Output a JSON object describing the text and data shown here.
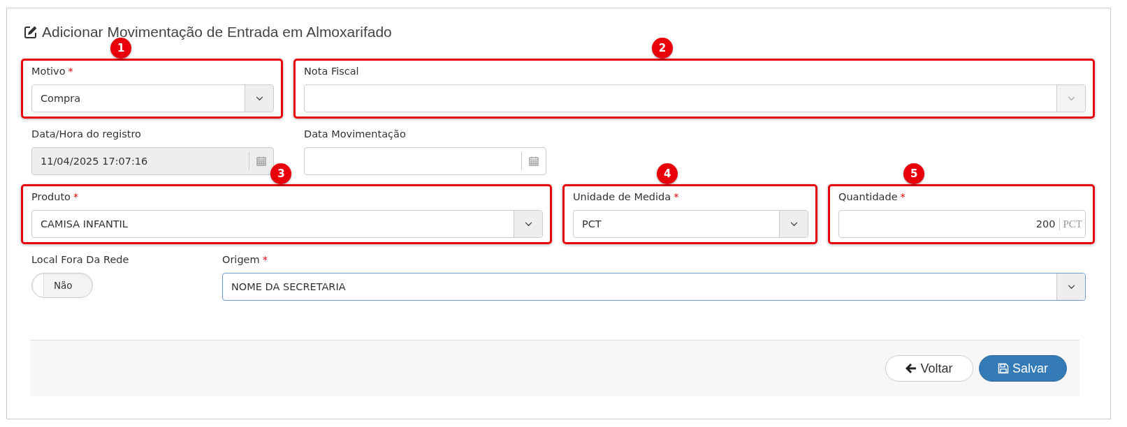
{
  "form": {
    "title": "Adicionar Movimentação de Entrada em Almoxarifado",
    "rows": [
      [
        {
          "kind": "select",
          "label": "Motivo",
          "marker": "*",
          "value": "Compra",
          "disabled": false,
          "focused": false,
          "callout": "1"
        },
        {
          "kind": "select",
          "label": "Nota Fiscal",
          "disabled": true,
          "focused": false,
          "callout": "2"
        }
      ],
      [
        {
          "kind": "date",
          "label": "Data/Hora do registro",
          "value": "11/04/2025 17:07:16",
          "disabled": true
        },
        {
          "kind": "date",
          "label": "Data Movimentação",
          "disabled": false
        }
      ],
      [
        {
          "kind": "select",
          "label": "Produto",
          "marker": "*",
          "value": "CAMISA INFANTIL",
          "disabled": false,
          "focused": false,
          "callout": "3"
        },
        {
          "kind": "select",
          "label": "Unidade de Medida",
          "marker": "*",
          "value": "PCT",
          "disabled": false,
          "focused": false,
          "callout": "4"
        },
        {
          "kind": "number",
          "label": "Quantidade",
          "marker": "*",
          "value": "200",
          "unit": "PCT",
          "callout": "5"
        }
      ],
      [
        {
          "kind": "toggle",
          "label": "Local Fora Da Rede",
          "value": "Não",
          "on": false
        },
        {
          "kind": "select",
          "label": "Origem",
          "marker": "*",
          "value": "NOME DA SECRETARIA",
          "disabled": false,
          "focused": true
        }
      ]
    ],
    "buttons": [
      {
        "kind": "default",
        "label": "Voltar"
      },
      {
        "kind": "primary",
        "label": "Salvar"
      }
    ]
  }
}
